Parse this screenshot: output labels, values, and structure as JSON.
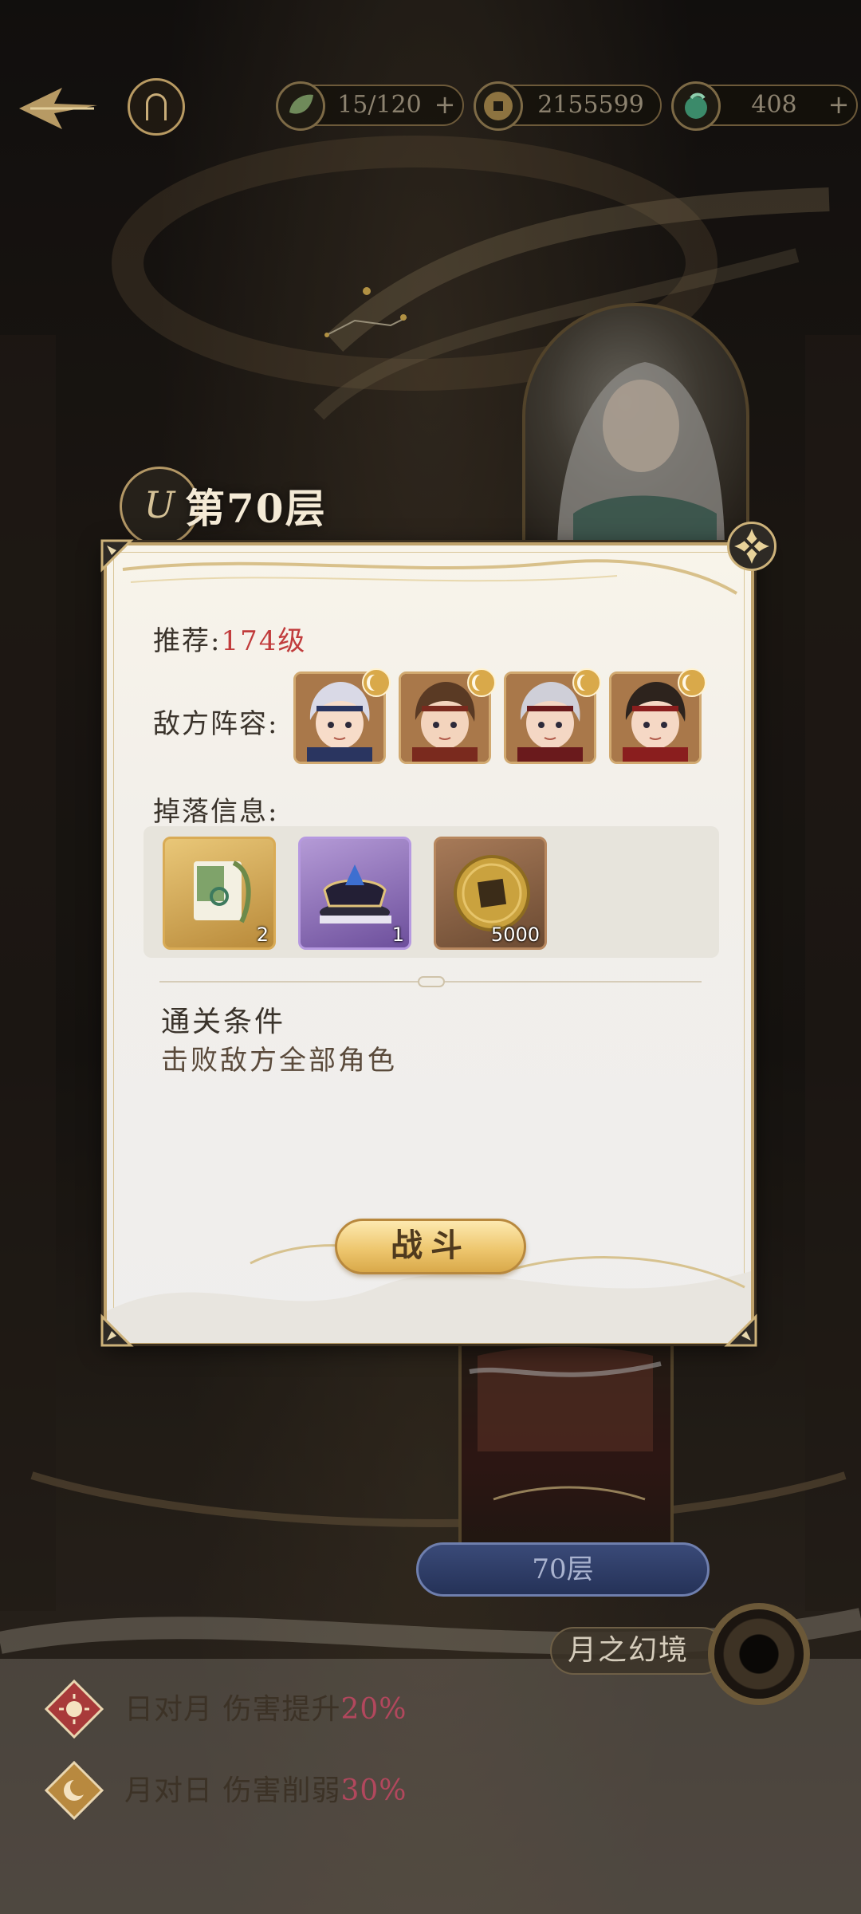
{
  "resources": [
    {
      "name": "stamina",
      "value": "15/120",
      "icon": "jade-leaf-icon",
      "has_plus": true
    },
    {
      "name": "coins",
      "value": "2155599",
      "icon": "coin-icon",
      "has_plus": false
    },
    {
      "name": "jade",
      "value": "408",
      "icon": "jade-icon",
      "has_plus": true
    }
  ],
  "floor": {
    "title": "第70层",
    "pill_label": "70层",
    "badge_glyph": "U"
  },
  "dialog": {
    "recommend_label": "推荐:",
    "recommend_value": "174级",
    "enemy_label": "敌方阵容:",
    "enemies": [
      {
        "name": "white-haired-headband-hero",
        "hair": "#d9d9e6",
        "face": "#f7dcc9",
        "band": "#2a3560"
      },
      {
        "name": "brown-haired-hero",
        "hair": "#5a3a24",
        "face": "#f3d4bd",
        "band": "#7a2a1e"
      },
      {
        "name": "silver-haired-hero",
        "hair": "#cfcfd8",
        "face": "#f4d7c4",
        "band": "#6a1a1c"
      },
      {
        "name": "dark-haired-hero",
        "hair": "#2d231d",
        "face": "#f5d8c5",
        "band": "#8a1e1e"
      }
    ],
    "drop_label": "掉落信息:",
    "drops": [
      {
        "name": "scroll-item",
        "count": "2",
        "rarity": "gold"
      },
      {
        "name": "crown-item",
        "count": "1",
        "rarity": "purple"
      },
      {
        "name": "coin-item",
        "count": "5000",
        "rarity": "brown"
      }
    ],
    "condition_title": "通关条件",
    "condition_text": "击败敌方全部角色",
    "fight_button": "战斗"
  },
  "realm": {
    "label": "月之幻境"
  },
  "buffs": [
    {
      "name": "sun-vs-moon",
      "prefix": "日对月  伤害提升",
      "value": "20%",
      "icon": "sun-icon"
    },
    {
      "name": "moon-vs-sun",
      "prefix": "月对日  伤害削弱",
      "value": "30%",
      "icon": "moon-icon"
    }
  ],
  "colors": {
    "accent_gold": "#bfa26b",
    "recommend_red": "#c13c3c",
    "buff_pink": "#b2475d"
  }
}
